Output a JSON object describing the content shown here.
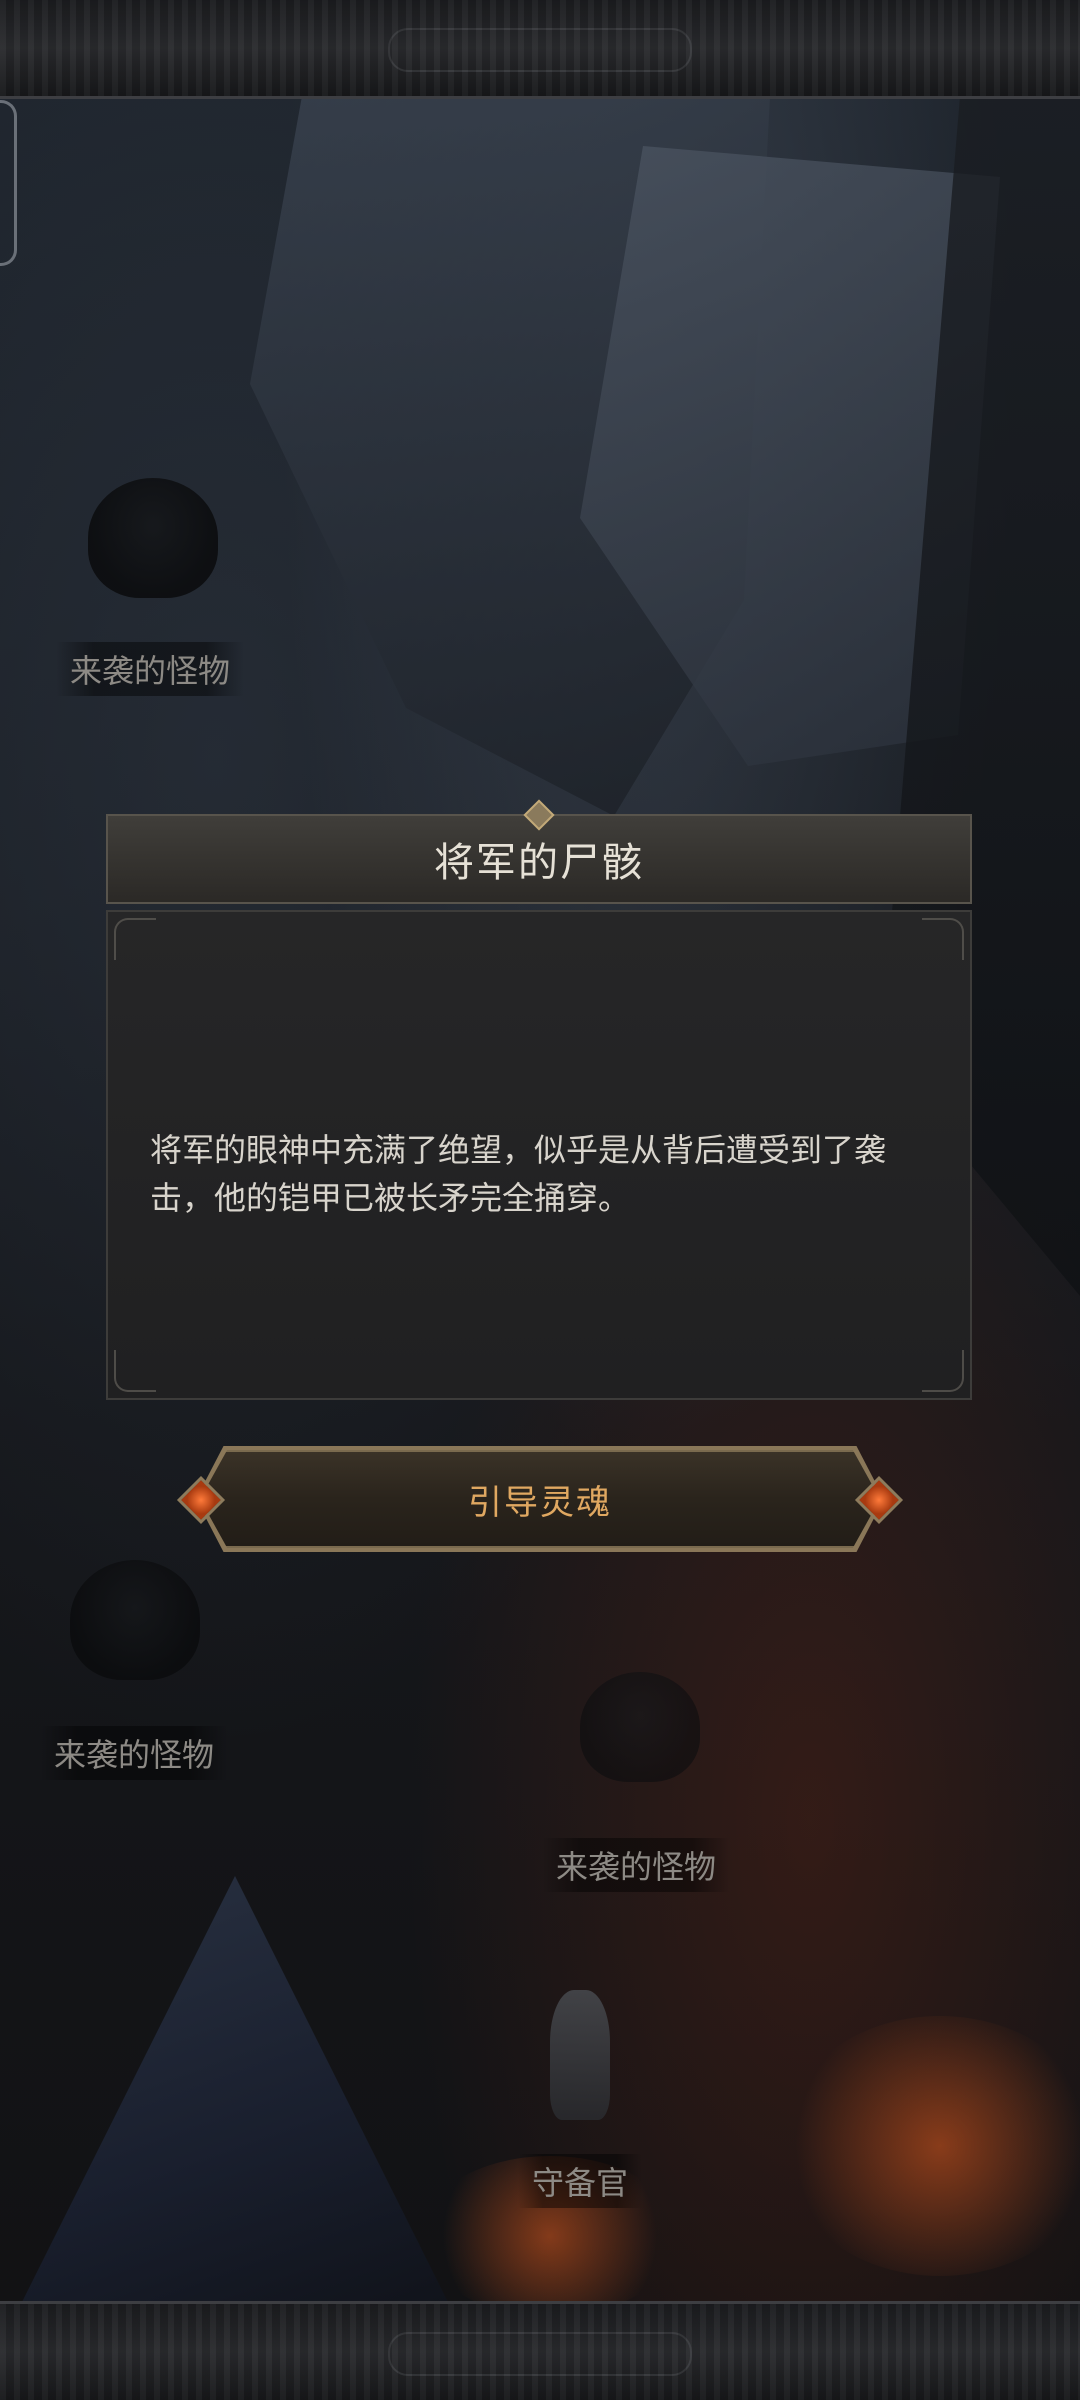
{
  "dialog": {
    "title": "将军的尸骸",
    "description": "将军的眼神中充满了绝望，似乎是从背后遭受到了袭击，他的铠甲已被长矛完全捅穿。"
  },
  "action": {
    "label": "引导灵魂"
  },
  "map_labels": {
    "monster_1": "来袭的怪物",
    "monster_2": "来袭的怪物",
    "monster_3": "来袭的怪物",
    "guard": "守备官"
  },
  "icons": {
    "gem": "orange-gem-icon",
    "frame": "ornate-frame"
  },
  "colors": {
    "title_text": "#e6e1d6",
    "body_text": "#d8d4cc",
    "action_text": "#e0a861",
    "label_text": "#8d8a85",
    "gem": "#ff7a3a"
  }
}
